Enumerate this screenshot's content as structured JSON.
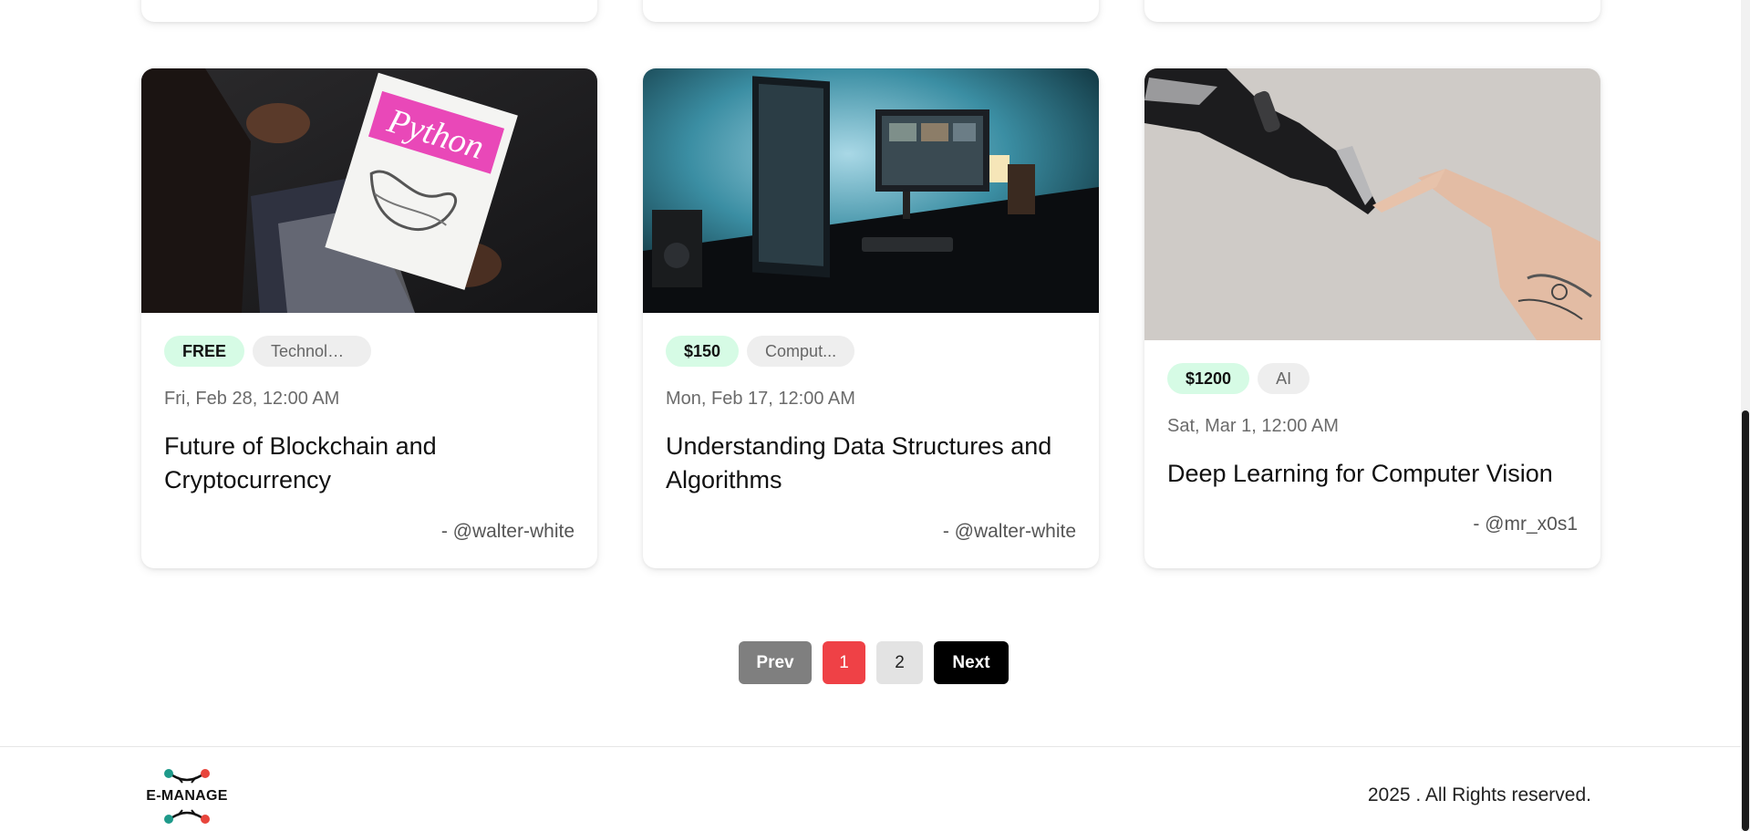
{
  "events": [
    {
      "price": "FREE",
      "category": "Technology",
      "date": "Fri, Feb 28, 12:00 AM",
      "title": "Future of Blockchain and Cryptocurrency",
      "author": "- @walter-white",
      "image_icon": "python-book-photo",
      "book_title": "Python"
    },
    {
      "price": "$150",
      "category": "Comput...",
      "date": "Mon, Feb 17, 12:00 AM",
      "title": "Understanding Data Structures and Algorithms",
      "author": "- @walter-white",
      "image_icon": "computer-desk-photo"
    },
    {
      "price": "$1200",
      "category": "AI",
      "date": "Sat, Mar 1, 12:00 AM",
      "title": "Deep Learning for Computer Vision",
      "author": "- @mr_x0s1",
      "image_icon": "robot-human-hand-photo"
    }
  ],
  "pagination": {
    "prev_label": "Prev",
    "pages": [
      "1",
      "2"
    ],
    "current_page": "1",
    "next_label": "Next"
  },
  "footer": {
    "logo_text": "E-MANAGE",
    "copyright": "2025 . All Rights reserved."
  },
  "colors": {
    "price_tag_bg": "#d6fbe5",
    "category_tag_bg": "#eeeeee",
    "active_page": "#ef4146",
    "prev_button": "#7f7f7f",
    "next_button": "#000000",
    "logo_teal": "#1e9a8a",
    "logo_red": "#e8453c"
  }
}
